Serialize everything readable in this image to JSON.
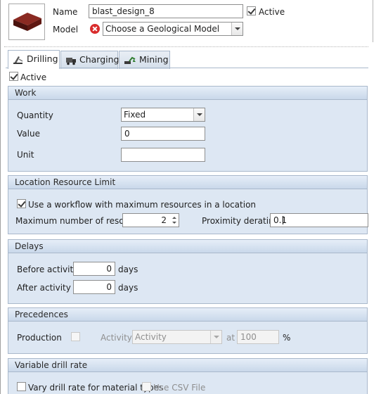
{
  "header": {
    "name_label": "Name",
    "name_value": "blast_design_8",
    "active_label": "Active",
    "active_checked": true,
    "model_label": "Model",
    "model_value": "Choose a Geological Model",
    "thumbnail_icon": "block-solid-icon"
  },
  "tabs": [
    {
      "label": "Drilling",
      "icon": "drill-icon",
      "active": true
    },
    {
      "label": "Charging",
      "icon": "truck-icon",
      "active": false
    },
    {
      "label": "Mining",
      "icon": "excavator-icon",
      "active": false
    }
  ],
  "drilling": {
    "active_label": "Active",
    "active_checked": true,
    "work": {
      "title": "Work",
      "quantity_label": "Quantity",
      "quantity_value": "Fixed",
      "value_label": "Value",
      "value_value": "0",
      "unit_label": "Unit",
      "unit_value": ""
    },
    "location_limit": {
      "title": "Location Resource Limit",
      "workflow_label": "Use a workflow with maximum resources in a location",
      "workflow_checked": true,
      "max_resources_label": "Maximum number of resources",
      "max_resources_value": "2",
      "proximity_label": "Proximity derating",
      "proximity_value": "0.1"
    },
    "delays": {
      "title": "Delays",
      "before_label": "Before activity",
      "before_value": "0",
      "before_unit": "days",
      "after_label": "After activity",
      "after_value": "0",
      "after_unit": "days"
    },
    "precedences": {
      "title": "Precedences",
      "production_label": "Production",
      "production_checked": false,
      "activity_label": "Activity",
      "activity_value": "Activity",
      "at_label": "at",
      "at_value": "100",
      "percent_label": "%"
    },
    "variable_rate": {
      "title": "Variable drill rate",
      "vary_label": "Vary drill rate for material types",
      "vary_checked": false,
      "csv_label": "Use CSV File",
      "csv_checked": false
    }
  },
  "colors": {
    "panel_bg": "#dde7f3",
    "panel_border": "#a9b8cb",
    "error_icon": "#d92c2c"
  }
}
